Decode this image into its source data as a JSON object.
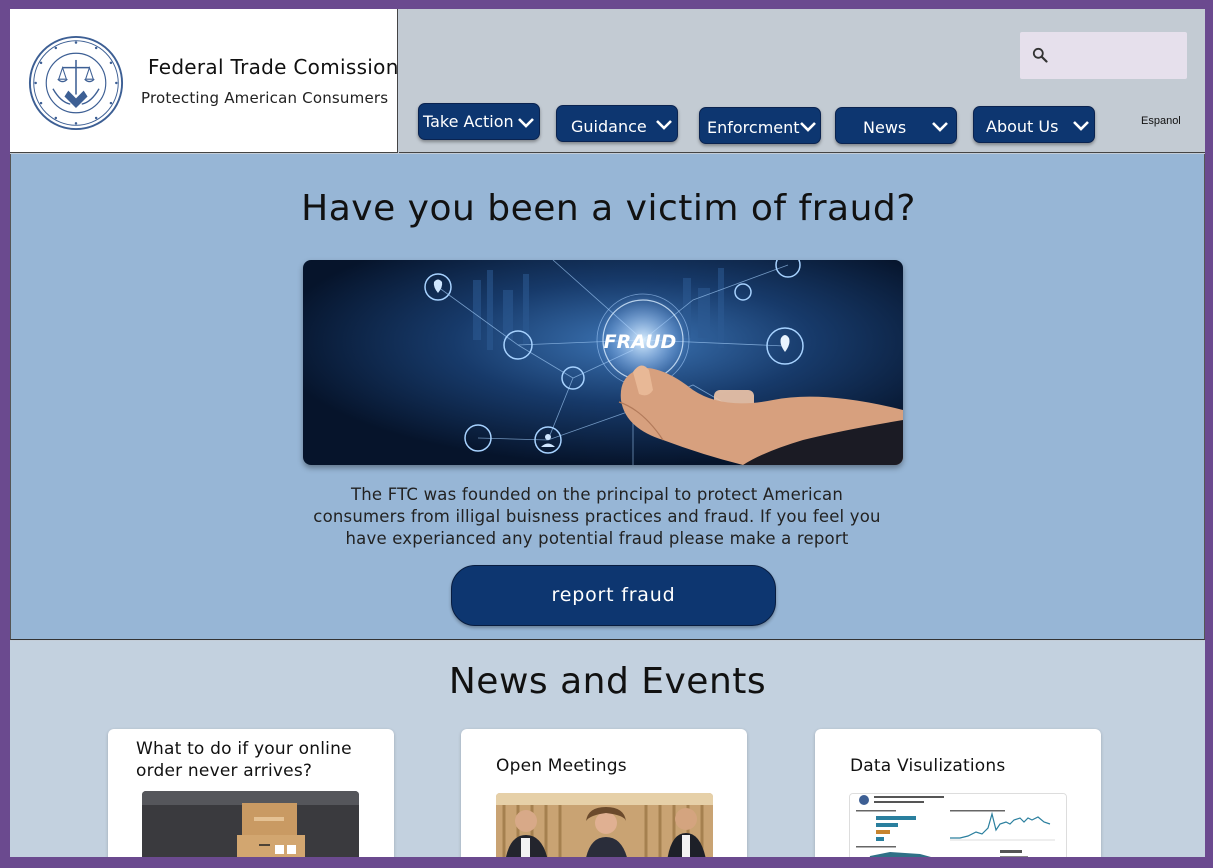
{
  "header": {
    "org_name": "Federal Trade Comission",
    "tagline": "Protecting American Consumers"
  },
  "search": {
    "placeholder": "",
    "icon": "search-icon"
  },
  "nav": {
    "items": [
      {
        "label": "Take Action"
      },
      {
        "label": "Guidance"
      },
      {
        "label": "Enforcment"
      },
      {
        "label": "News"
      },
      {
        "label": "About Us"
      }
    ],
    "language_link": "Espanol"
  },
  "hero": {
    "title": "Have you been a victim of fraud?",
    "image_label": "FRAUD",
    "description": "The FTC was founded on the principal to protect American consumers from illigal buisness practices and fraud.  If you feel you have experianced any potential fraud please make a report",
    "button_label": "report fraud"
  },
  "news": {
    "title": "News and Events",
    "cards": [
      {
        "title": "What to do if your online order never arrives?"
      },
      {
        "title": "Open Meetings"
      },
      {
        "title": "Data Visulizations"
      }
    ]
  },
  "colors": {
    "navy": "#0d3670",
    "hero_bg": "#97b6d6",
    "news_bg": "#c3d1df",
    "frame": "#6b4a8f"
  }
}
